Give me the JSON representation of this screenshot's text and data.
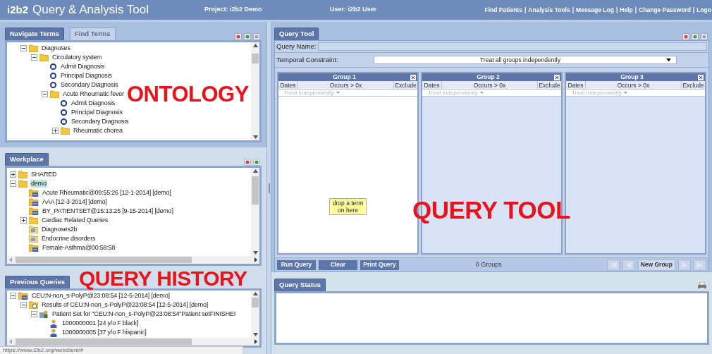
{
  "header": {
    "logo": "i2b2",
    "title": "Query & Analysis Tool",
    "project": "Project: i2b2 Demo",
    "user": "User: i2b2 User",
    "separator": "|",
    "links": [
      "Find Patients",
      "Analysis Tools",
      "Message Log",
      "Help",
      "Change Password",
      "Logo"
    ]
  },
  "ontology": {
    "tabs": [
      {
        "label": "Navigate Terms",
        "selected": true
      },
      {
        "label": "Find Terms",
        "selected": false
      }
    ],
    "tree": [
      {
        "kind": "folder",
        "label": "Diagnoses",
        "expanded": true,
        "children": [
          {
            "kind": "folder",
            "label": "Circulatory system",
            "expanded": true,
            "children": [
              {
                "kind": "concept",
                "label": "Admit Diagnosis"
              },
              {
                "kind": "concept",
                "label": "Principal Diagnosis"
              },
              {
                "kind": "concept",
                "label": "Secondary Diagnosis"
              },
              {
                "kind": "folder",
                "label": "Acute Rheumatic fever",
                "expanded": true,
                "children": [
                  {
                    "kind": "concept",
                    "label": "Admit Diagnosis"
                  },
                  {
                    "kind": "concept",
                    "label": "Principal Diagnosis"
                  },
                  {
                    "kind": "concept",
                    "label": "Secondary Diagnosis"
                  },
                  {
                    "kind": "folder",
                    "label": "Rheumatic chorea",
                    "expanded": false
                  }
                ]
              }
            ]
          }
        ]
      }
    ]
  },
  "workplace": {
    "tab": "Workplace",
    "tree": [
      {
        "kind": "folder",
        "label": "SHARED",
        "expanded": false,
        "selected": false
      },
      {
        "kind": "folder",
        "label": "demo",
        "expanded": true,
        "selected": true,
        "children": [
          {
            "kind": "query",
            "label": "Acute Rheumatic@09:55:26 [12-1-2014] [demo]",
            "selected": false
          },
          {
            "kind": "query",
            "label": "AAA [12-3-2014] [demo]",
            "selected": false
          },
          {
            "kind": "query",
            "label": "BY_PATIENTSET@15:13:25 [9-15-2014] [demo]",
            "selected": false
          },
          {
            "kind": "folder",
            "label": "Cardiac Related Queries",
            "expanded": false,
            "selected": false
          },
          {
            "kind": "term",
            "label": "Diagnoses2b",
            "selected": false
          },
          {
            "kind": "term",
            "label": "Endocrine disorders",
            "selected": false
          },
          {
            "kind": "query",
            "label": "Female-Asthma@00:58:58",
            "selected": false
          }
        ]
      }
    ]
  },
  "previous_queries": {
    "tab": "Previous Queries",
    "tree": [
      {
        "kind": "query",
        "label": "CEU:N-non_s-PolyP@23:08:54 [12-5-2014] [demo]",
        "expanded": true,
        "children": [
          {
            "kind": "results",
            "label": "Results of CEU:N-non_s-PolyP@23:08:54 [12-5-2014] [demo]",
            "expanded": true,
            "children": [
              {
                "kind": "patient_set",
                "label": "Patient Set for \"CEU:N-non_s-PolyP@23:08:54\"Patient setFINISHEI",
                "expanded": true,
                "children": [
                  {
                    "kind": "patient",
                    "label": "1000000001 [24 y/o F black]"
                  },
                  {
                    "kind": "patient",
                    "label": "1000000005 [37 y/o F hispanic]"
                  }
                ]
              }
            ]
          }
        ]
      }
    ]
  },
  "query_tool": {
    "tab": "Query Tool",
    "query_name_label": "Query Name:",
    "temporal_label": "Temporal Constraint:",
    "temporal_value": "Treat all groups independently",
    "groups": [
      {
        "title": "Group 1",
        "selected": true,
        "dates": "Dates",
        "occurs": "Occurs > 0x",
        "exclude": "Exclude",
        "timing": "Treat Independently",
        "drop_hint": "drop a term on here"
      },
      {
        "title": "Group 2",
        "selected": false,
        "dates": "Dates",
        "occurs": "Occurs > 0x",
        "exclude": "Exclude",
        "timing": "Treat Independently"
      },
      {
        "title": "Group 3",
        "selected": false,
        "dates": "Dates",
        "occurs": "Occurs > 0x",
        "exclude": "Exclude",
        "timing": "Treat Independently"
      }
    ],
    "buttons": [
      "Run Query",
      "Clear",
      "Print Query"
    ],
    "group_count": "0 Groups",
    "new_group": "New Group"
  },
  "query_status": {
    "tab": "Query Status"
  },
  "annotations": [
    {
      "kind": "ontology",
      "text": "ONTOLOGY"
    },
    {
      "kind": "history",
      "text": "QUERY HISTORY"
    },
    {
      "kind": "tool",
      "text": "QUERY TOOL"
    }
  ],
  "status_url": "https://www.i2b2.org/webclient/#"
}
